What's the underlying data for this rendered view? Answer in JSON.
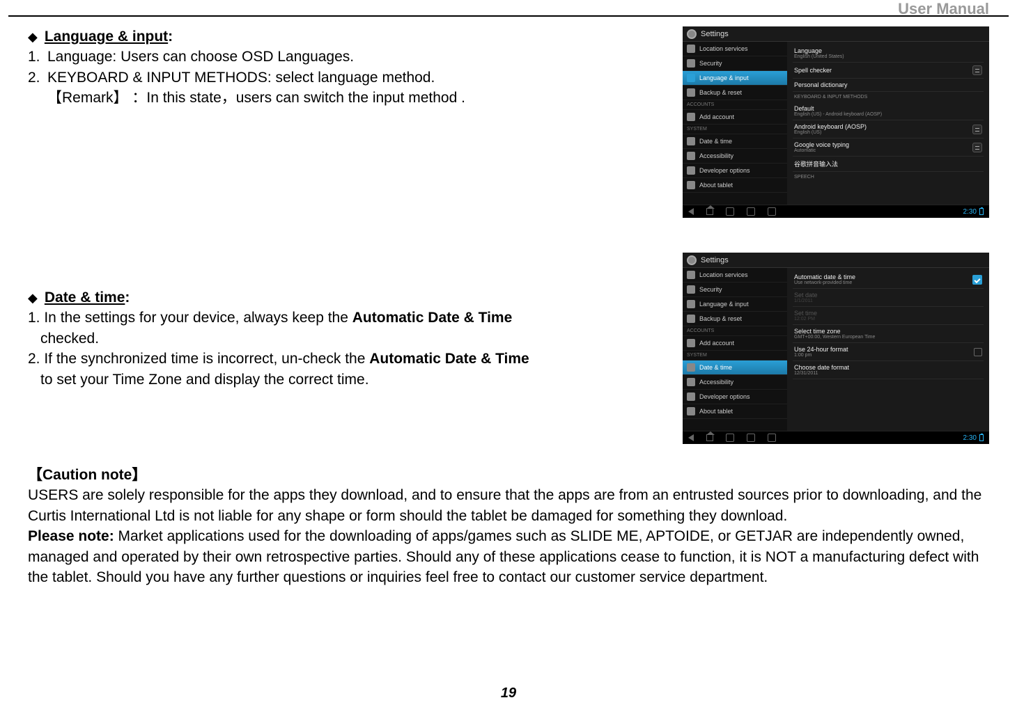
{
  "header": {
    "right": "User Manual"
  },
  "page_number": "19",
  "sec1": {
    "title": "Language & input",
    "item1": "Language: Users can choose OSD Languages.",
    "item2": "KEYBOARD & INPUT METHODS: select language method.",
    "remark_label": "【Remark】 ：",
    "remark_text": "In this state，users can switch the input method ."
  },
  "sec2": {
    "title": "Date & time",
    "item1_a": "1. In the settings for your device, always keep the ",
    "item1_bold": "Automatic Date & Time",
    "item1_b": " checked.",
    "item2_a": "2. If the synchronized time is incorrect, un-check the ",
    "item2_bold": "Automatic Date & Time",
    "item2_b": " to set your Time Zone and display the correct time."
  },
  "caution": {
    "title": "【Caution note】",
    "p1": "USERS are solely responsible for the apps they download, and to ensure that the apps are from an entrusted sources prior to downloading, and the Curtis International Ltd is not liable for any shape or form should the   tablet be damaged for something they download.",
    "p2_bold": "Please note:",
    "p2": " Market applications used for the downloading of apps/games such as SLIDE ME, APTOIDE, or GETJAR are independently owned, managed and operated by their own retrospective parties. Should any of these applications cease to function, it is NOT a manufacturing defect with the tablet. Should you have any further questions or inquiries feel free to contact our customer service department."
  },
  "shot_common": {
    "settings": "Settings",
    "time": "2:30",
    "sidebar": {
      "location": "Location services",
      "security": "Security",
      "lang": "Language & input",
      "backup": "Backup & reset",
      "accounts_cat": "ACCOUNTS",
      "add_account": "Add account",
      "system_cat": "SYSTEM",
      "datetime": "Date & time",
      "accessibility": "Accessibility",
      "developer": "Developer options",
      "about": "About tablet"
    }
  },
  "shot1": {
    "language": {
      "t": "Language",
      "s": "English (United States)"
    },
    "spell": {
      "t": "Spell checker"
    },
    "dict": {
      "t": "Personal dictionary"
    },
    "cat_kbd": "KEYBOARD & INPUT METHODS",
    "default": {
      "t": "Default",
      "s": "English (US) - Android keyboard (AOSP)"
    },
    "android_kbd": {
      "t": "Android keyboard (AOSP)",
      "s": "English (US)"
    },
    "gvoice": {
      "t": "Google voice typing",
      "s": "Automatic"
    },
    "pinyin": {
      "t": "谷歌拼音输入法"
    },
    "cat_speech": "SPEECH"
  },
  "shot2": {
    "auto": {
      "t": "Automatic date & time",
      "s": "Use network-provided time"
    },
    "setdate": {
      "t": "Set date",
      "s": "1/1/2011"
    },
    "settime": {
      "t": "Set time",
      "s": "12:02 PM"
    },
    "tz": {
      "t": "Select time zone",
      "s": "GMT+00:00, Western European Time"
    },
    "h24": {
      "t": "Use 24-hour format",
      "s": "1:00 pm"
    },
    "fmt": {
      "t": "Choose date format",
      "s": "12/31/2011"
    }
  }
}
